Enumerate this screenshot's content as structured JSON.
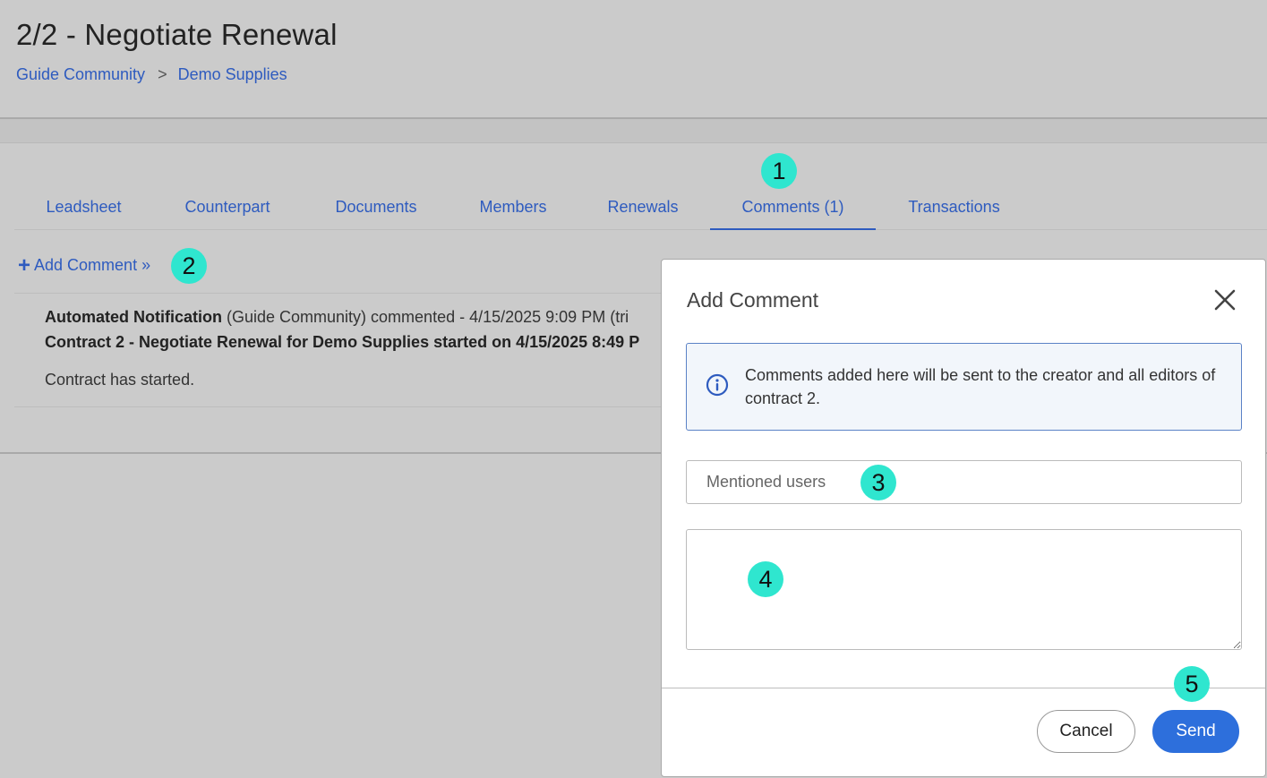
{
  "header": {
    "title": "2/2 - Negotiate Renewal",
    "breadcrumb": [
      "Guide Community",
      "Demo Supplies"
    ],
    "breadcrumb_separator": ">"
  },
  "tabs": [
    {
      "label": "Leadsheet",
      "active": false
    },
    {
      "label": "Counterpart",
      "active": false
    },
    {
      "label": "Documents",
      "active": false
    },
    {
      "label": "Members",
      "active": false
    },
    {
      "label": "Renewals",
      "active": false
    },
    {
      "label": "Comments (1)",
      "active": true
    },
    {
      "label": "Transactions",
      "active": false
    }
  ],
  "add_comment_link": "Add Comment »",
  "comment": {
    "author": "Automated Notification",
    "meta": " (Guide Community) commented - 4/15/2025 9:09 PM (tri",
    "subject": "Contract 2 - Negotiate Renewal for Demo Supplies started on 4/15/2025 8:49 P",
    "body": "Contract has started."
  },
  "modal": {
    "title": "Add Comment",
    "info_text": "Comments added here will be sent to the creator and all editors of contract 2.",
    "mention_placeholder": "Mentioned users",
    "comment_value": "",
    "cancel_label": "Cancel",
    "send_label": "Send"
  },
  "step_markers": [
    "1",
    "2",
    "3",
    "4",
    "5"
  ],
  "colors": {
    "link": "#2e5bbf",
    "primary_button": "#2d6fdc",
    "step_marker": "#2fe6cf",
    "info_border": "#5b82c6"
  },
  "icons": {
    "close": "close-icon",
    "info": "info-icon",
    "plus": "plus-icon",
    "resize": "resize-grip-icon"
  }
}
